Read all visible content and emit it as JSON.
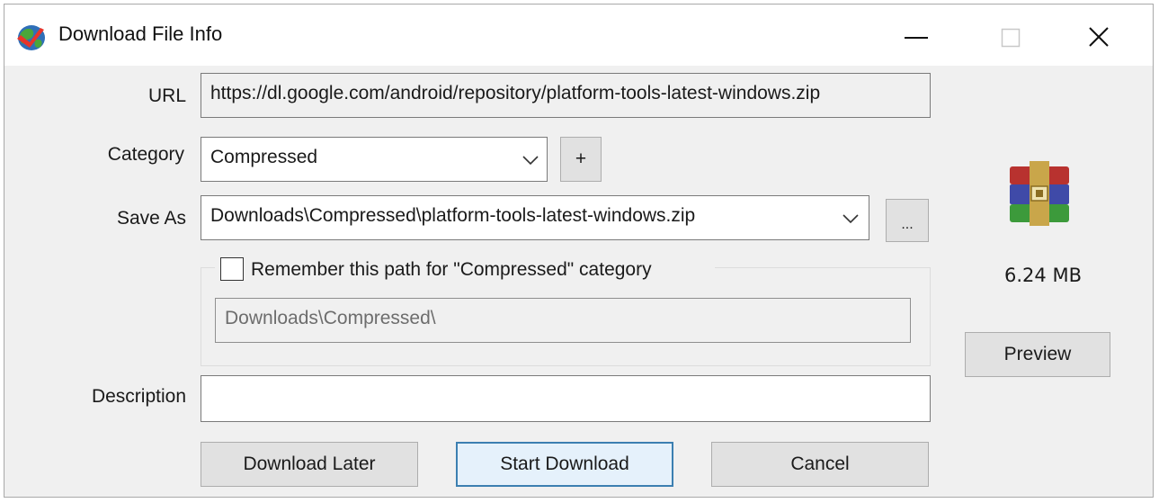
{
  "window": {
    "title": "Download File Info",
    "icon": "idm-globe-icon"
  },
  "titlebar": {
    "minimize_icon": "minimize-icon",
    "maximize_icon": "maximize-icon",
    "close_icon": "close-icon"
  },
  "url": {
    "label": "URL",
    "value": "https://dl.google.com/android/repository/platform-tools-latest-windows.zip"
  },
  "category": {
    "label": "Category",
    "selected": "Compressed",
    "add_button": "+"
  },
  "save_as": {
    "label": "Save As",
    "value": "Downloads\\Compressed\\platform-tools-latest-windows.zip",
    "browse_button": "..."
  },
  "remember": {
    "checked": false,
    "label": "Remember this path for \"Compressed\" category",
    "path": "Downloads\\Compressed\\"
  },
  "description": {
    "label": "Description",
    "value": ""
  },
  "file_info": {
    "icon": "winrar-archive-icon",
    "size": "6.24  MB",
    "preview_button": "Preview"
  },
  "actions": {
    "download_later": "Download Later",
    "start_download": "Start Download",
    "cancel": "Cancel"
  },
  "colors": {
    "dialog_bg": "#f0f0f0",
    "default_button_border": "#3c7fb1",
    "field_border": "#7a7a7a"
  }
}
